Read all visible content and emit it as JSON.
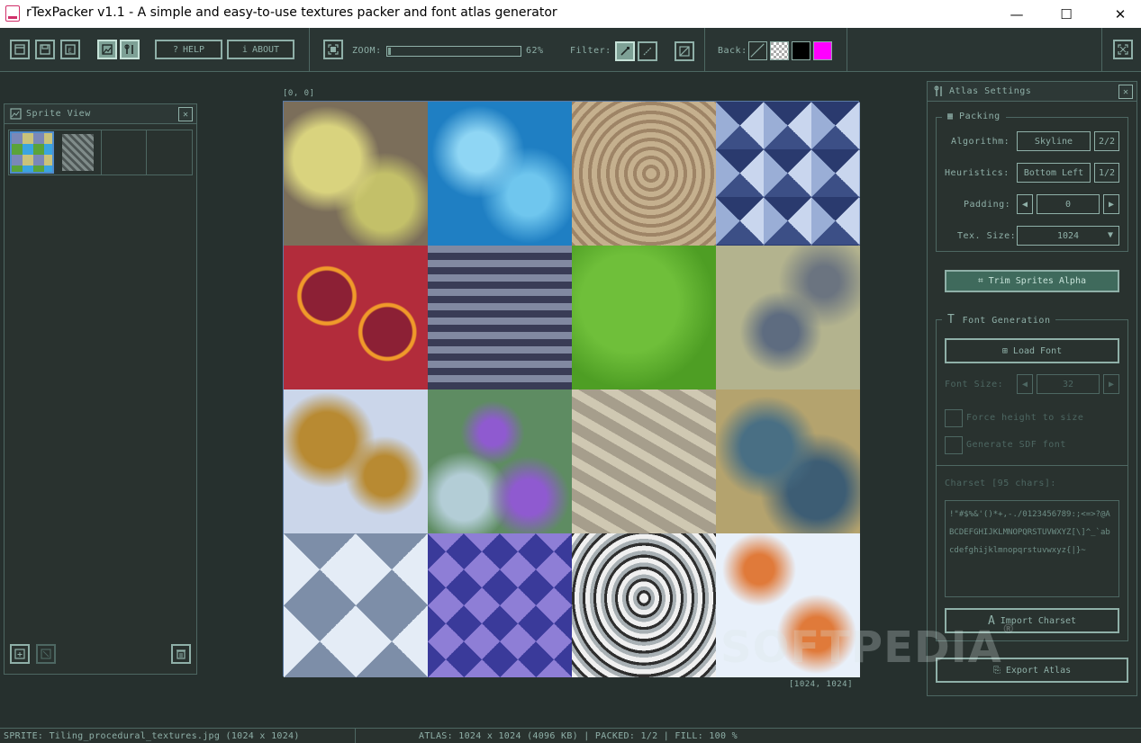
{
  "window": {
    "title": "rTexPacker v1.1 - A simple and easy-to-use textures packer and font atlas generator",
    "minimize_glyph": "—",
    "maximize_glyph": "☐",
    "close_glyph": "✕"
  },
  "toolbar": {
    "help_label": "HELP",
    "about_label": "ABOUT",
    "zoom_label": "ZOOM:",
    "zoom_value": "62%",
    "zoom_fraction": 0.62,
    "filter_label": "Filter:",
    "back_label": "Back:",
    "back_colors": [
      "#ffffff",
      "#000000",
      "#ff00ff"
    ]
  },
  "sprite_view": {
    "title": "Sprite View",
    "close_glyph": "✕"
  },
  "atlas_canvas": {
    "top_left_coord": "[0, 0]",
    "bottom_right_coord": "[1024, 1024]"
  },
  "atlas_settings": {
    "title": "Atlas Settings",
    "close_glyph": "✕",
    "packing": {
      "title": "Packing",
      "algorithm_label": "Algorithm:",
      "algorithm_value": "Skyline",
      "algorithm_index": "2/2",
      "heuristics_label": "Heuristics:",
      "heuristics_value": "Bottom Left",
      "heuristics_index": "1/2",
      "padding_label": "Padding:",
      "padding_value": "0",
      "tex_size_label": "Tex. Size:",
      "tex_size_value": "1024"
    },
    "trim_button": "Trim Sprites Alpha",
    "font_generation": {
      "title": "Font Generation",
      "load_font_button": "Load Font",
      "font_size_label": "Font Size:",
      "font_size_value": "32",
      "force_height_label": "Force height to size",
      "sdf_label": "Generate SDF font",
      "charset_label": "Charset [95 chars]:",
      "charset_text": "!\"#$%&'()*+,-./0123456789:;<=>?@ABCDEFGHIJKLMNOPQRSTUVWXYZ[\\]^_`abcdefghijklmnopqrstuvwxyz{|}~",
      "import_charset_button": "Import Charset"
    },
    "export_button": "Export Atlas"
  },
  "status": {
    "sprite": "SPRITE: Tiling_procedural_textures.jpg (1024 x 1024)",
    "atlas": "ATLAS: 1024 x 1024 (4096 KB)  |  PACKED: 1/2  |  FILL: 100 %"
  },
  "watermark": "SOFTPEDIA",
  "watermark_mark": "®",
  "colors": {
    "accent": "#8fb0a8",
    "active_button": "#7ea196",
    "background": "#26302e",
    "panel": "#29322f",
    "border": "#4d6762"
  }
}
